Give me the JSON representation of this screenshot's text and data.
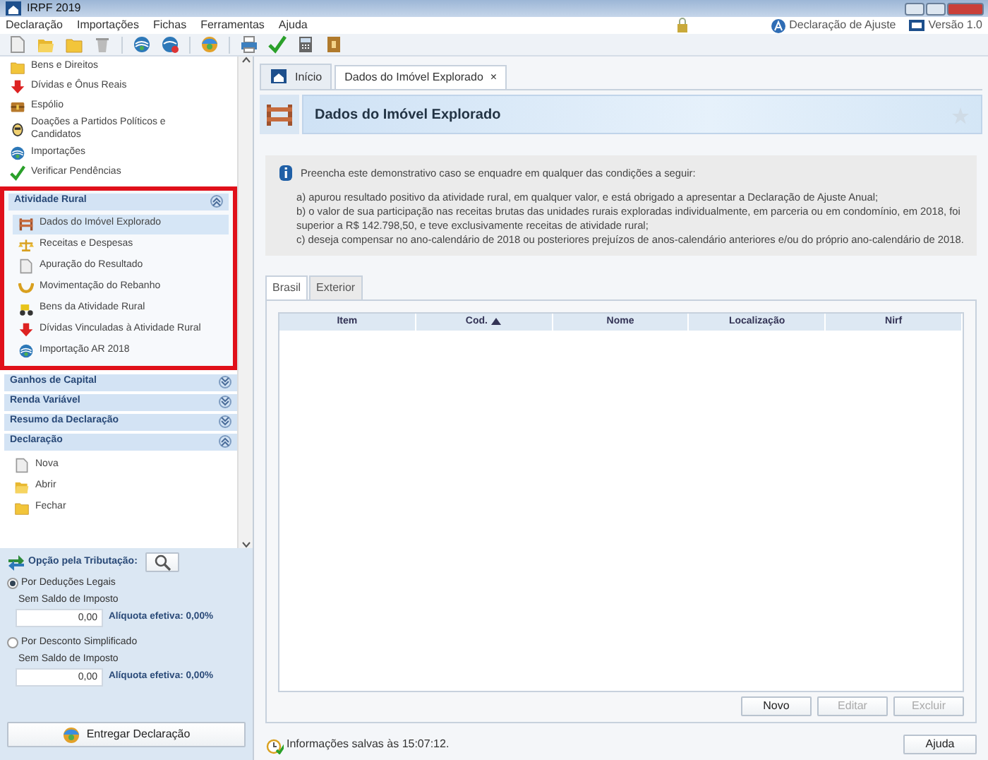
{
  "window": {
    "title": "IRPF 2019"
  },
  "menu": [
    "Declaração",
    "Importações",
    "Fichas",
    "Ferramentas",
    "Ajuda"
  ],
  "header_info": {
    "declaration_type": "Declaração de Ajuste",
    "version": "Versão 1.0"
  },
  "sidebar": {
    "items": [
      {
        "label": "Bens e Direitos"
      },
      {
        "label": "Dívidas e Ônus Reais"
      },
      {
        "label": "Espólio"
      },
      {
        "label": "Doações a Partidos Políticos e Candidatos"
      },
      {
        "label": "Importações"
      },
      {
        "label": "Verificar Pendências"
      }
    ],
    "sections": [
      {
        "title": "Atividade Rural",
        "expanded": true,
        "highlighted": true,
        "items": [
          {
            "label": "Dados do Imóvel Explorado",
            "selected": true
          },
          {
            "label": "Receitas e Despesas",
            "selected": false
          },
          {
            "label": "Apuração do Resultado",
            "selected": false
          },
          {
            "label": "Movimentação do Rebanho",
            "selected": false
          },
          {
            "label": "Bens da Atividade Rural",
            "selected": false
          },
          {
            "label": "Dívidas Vinculadas à Atividade Rural",
            "selected": false
          },
          {
            "label": "Importação AR 2018",
            "selected": false
          }
        ]
      },
      {
        "title": "Ganhos de Capital",
        "expanded": false,
        "highlighted": false
      },
      {
        "title": "Renda Variável",
        "expanded": false,
        "highlighted": false
      },
      {
        "title": "Resumo da Declaração",
        "expanded": false,
        "highlighted": false
      },
      {
        "title": "Declaração",
        "expanded": true,
        "highlighted": false,
        "items": [
          {
            "label": "Nova",
            "selected": false
          },
          {
            "label": "Abrir",
            "selected": false
          },
          {
            "label": "Fechar",
            "selected": false
          }
        ]
      }
    ]
  },
  "tax_option": {
    "label": "Opção pela Tributação:",
    "options": [
      {
        "label": "Por Deduções Legais",
        "selected": true,
        "sublabel": "Sem Saldo de Imposto",
        "value": "0,00",
        "rate": "Alíquota efetiva: 0,00%"
      },
      {
        "label": "Por Desconto Simplificado",
        "selected": false,
        "sublabel": "Sem Saldo de Imposto",
        "value": "0,00",
        "rate": "Alíquota efetiva: 0,00%"
      }
    ],
    "submit_button": "Entregar Declaração"
  },
  "tabs": [
    {
      "label": "Início",
      "selected": false,
      "closable": false
    },
    {
      "label": "Dados do Imóvel Explorado",
      "selected": true,
      "closable": true
    }
  ],
  "tab_close": "×",
  "page_title": "Dados do Imóvel Explorado",
  "info": {
    "intro": "Preencha este demonstrativo caso se enquadre em qualquer das condições a seguir:",
    "conditions": [
      "a) apurou resultado positivo da atividade rural, em qualquer valor, e está obrigado a apresentar a Declaração de Ajuste Anual;",
      "b) o valor de sua participação nas receitas brutas das unidades rurais exploradas individualmente, em parceria ou em condomínio, em 2018, foi superior a R$ 142.798,50, e teve exclusivamente receitas de atividade rural;",
      "c) deseja compensar no ano-calendário de 2018 ou posteriores prejuízos de anos-calendário anteriores e/ou do próprio ano-calendário de 2018."
    ]
  },
  "subtabs": [
    {
      "label": "Brasil",
      "selected": true
    },
    {
      "label": "Exterior",
      "selected": false
    }
  ],
  "table": {
    "columns": [
      {
        "label": "Item",
        "sorted": false
      },
      {
        "label": "Cod.",
        "sorted": true
      },
      {
        "label": "Nome",
        "sorted": false
      },
      {
        "label": "Localização",
        "sorted": false
      },
      {
        "label": "Nirf",
        "sorted": false
      }
    ]
  },
  "buttons": [
    {
      "label": "Novo",
      "disabled": false
    },
    {
      "label": "Editar",
      "disabled": true
    },
    {
      "label": "Excluir",
      "disabled": true
    }
  ],
  "status": {
    "text": "Informações salvas às 15:07:12.",
    "help_button": "Ajuda"
  }
}
